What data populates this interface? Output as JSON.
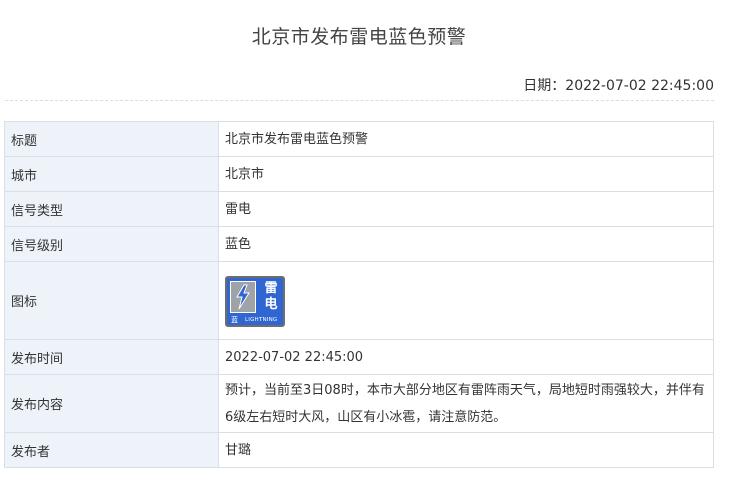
{
  "header": {
    "title": "北京市发布雷电蓝色预警",
    "date_label": "日期：",
    "date_value": "2022-07-02 22:45:00"
  },
  "table": {
    "rows": [
      {
        "label": "标题",
        "value": "北京市发布雷电蓝色预警"
      },
      {
        "label": "城市",
        "value": "北京市"
      },
      {
        "label": "信号类型",
        "value": "雷电"
      },
      {
        "label": "信号级别",
        "value": "蓝色"
      },
      {
        "label": "图标",
        "value": ""
      },
      {
        "label": "发布时间",
        "value": "2022-07-02 22:45:00"
      },
      {
        "label": "发布内容",
        "value": "预计，当前至3日08时，本市大部分地区有雷阵雨天气，局地短时雨强较大，并伴有6级左右短时大风，山区有小冰雹，请注意防范。"
      },
      {
        "label": "发布者",
        "value": "甘璐"
      }
    ]
  },
  "icon": {
    "name": "lightning-blue-warning-icon",
    "char_top": "雷",
    "char_bottom": "电",
    "level_text": "蓝",
    "english_text": "LIGHTNING",
    "colors": {
      "background": "#2f66d1",
      "panel": "#9ea3a8",
      "bolt": "#2f66d1"
    }
  }
}
